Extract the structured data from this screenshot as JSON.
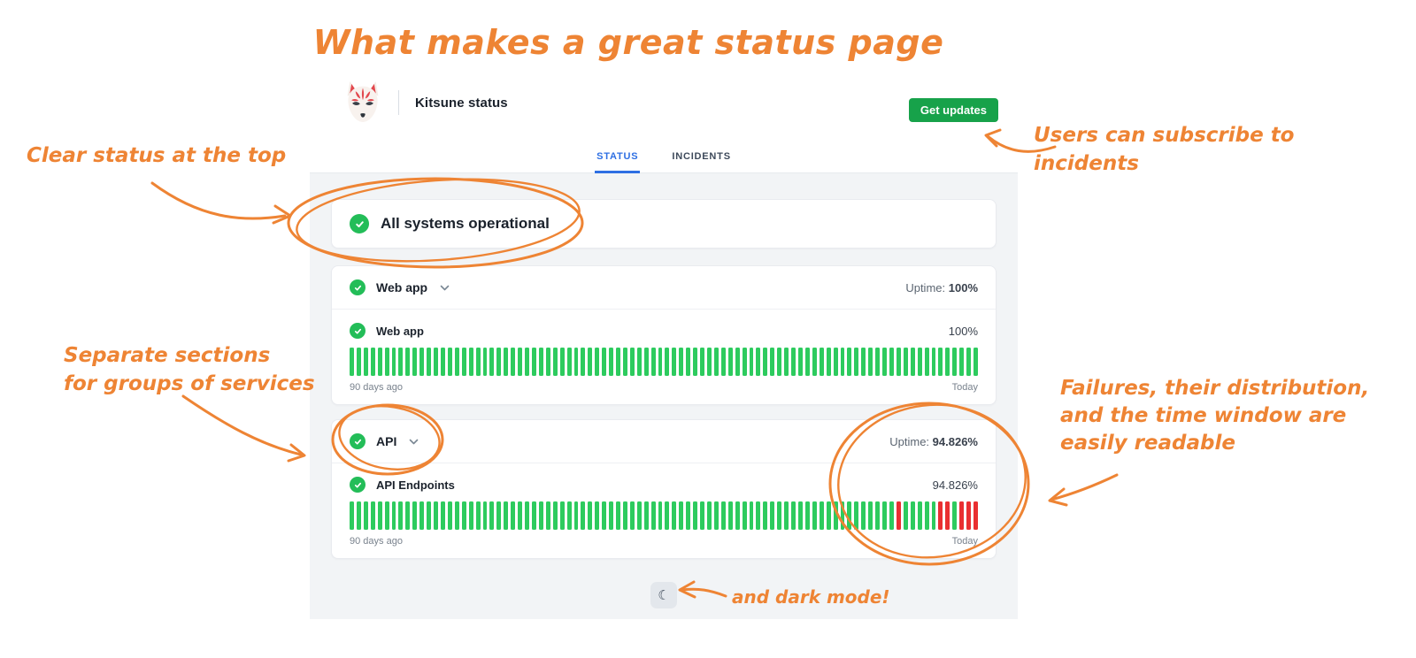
{
  "annotations": {
    "title": "What makes a great status page",
    "notes": {
      "clear_status": "Clear status at the top",
      "separate_sections": [
        "Separate sections",
        "for groups of services"
      ],
      "subscribe": [
        "Users can subscribe to",
        "incidents"
      ],
      "failures": [
        "Failures, their distribution,",
        "and the time window are",
        "easily readable"
      ],
      "dark_mode": "and dark mode!"
    }
  },
  "status_page": {
    "brand_name": "Kitsune status",
    "logo": "kitsune-fox-mask-icon",
    "get_updates_label": "Get updates",
    "tabs": {
      "status": "STATUS",
      "incidents": "INCIDENTS",
      "active": "STATUS"
    },
    "overall_status": "All systems operational",
    "groups": [
      {
        "name": "Web app",
        "uptime_label": "Uptime:",
        "uptime_value": "100%",
        "services": [
          {
            "name": "Web app",
            "uptime": "100%",
            "window_start": "90 days ago",
            "window_end": "Today",
            "bars": {
              "total": 90,
              "red_indices": []
            }
          }
        ]
      },
      {
        "name": "API",
        "uptime_label": "Uptime:",
        "uptime_value": "94.826%",
        "services": [
          {
            "name": "API Endpoints",
            "uptime": "94.826%",
            "window_start": "90 days ago",
            "window_end": "Today",
            "bars": {
              "total": 90,
              "red_indices": [
                78,
                84,
                85,
                87,
                88,
                89
              ]
            }
          }
        ]
      }
    ],
    "dark_mode_icon": "moon",
    "dark_mode_glyph": "☾"
  },
  "colors": {
    "accent_orange": "#EE8434",
    "ok_green": "#23BD58",
    "button_green": "#17A24A",
    "bar_green": "#2DCB5E",
    "bar_red": "#E92F31",
    "tab_blue": "#2E6FE3"
  }
}
